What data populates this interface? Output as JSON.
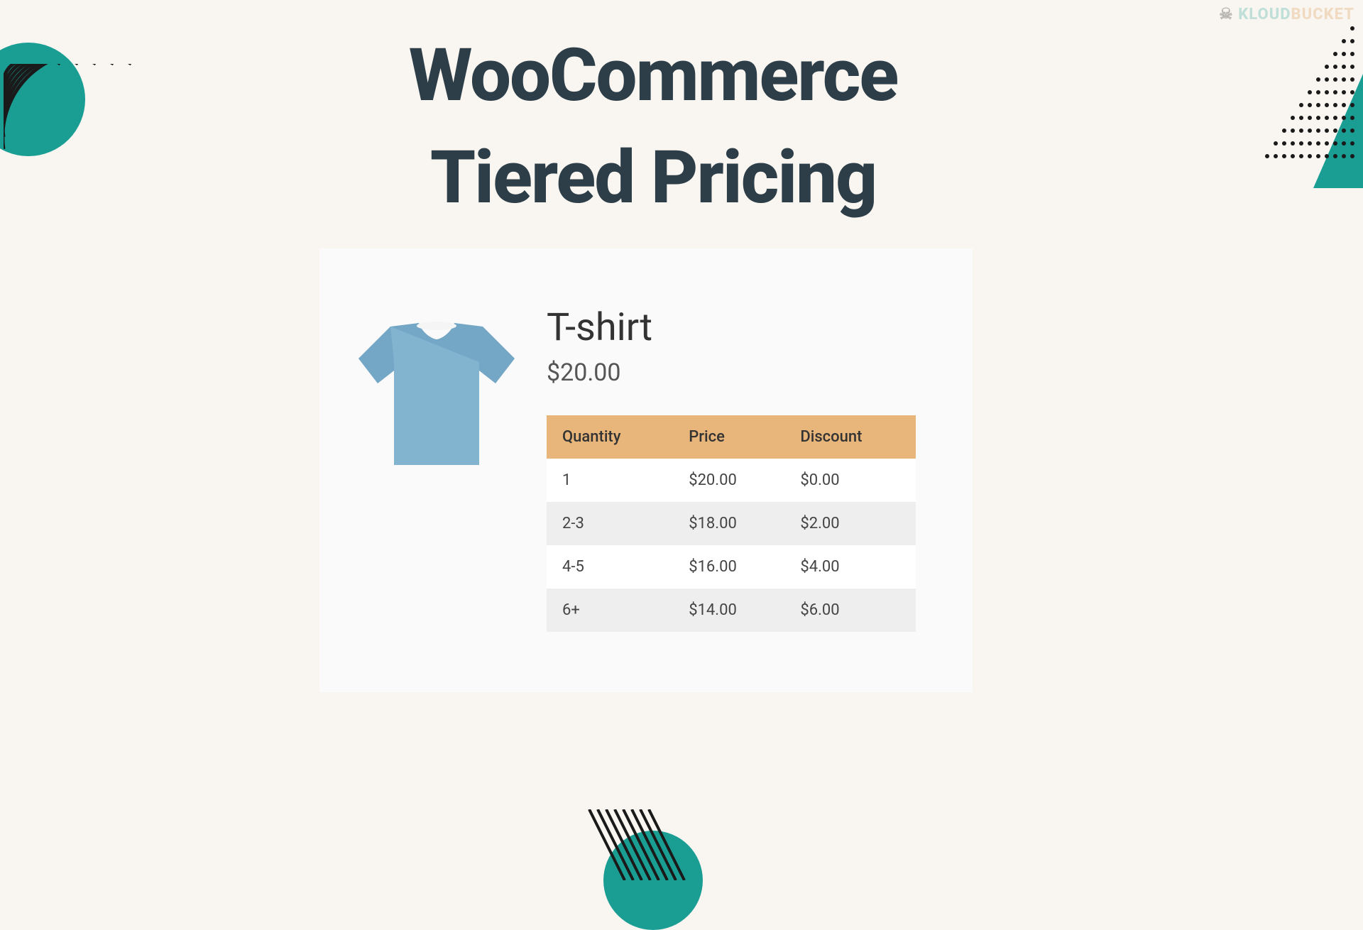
{
  "watermark": {
    "part1": "KLOUD",
    "part2": "BUCKET"
  },
  "title": {
    "line1": "WooCommerce",
    "line2": "Tiered Pricing"
  },
  "product": {
    "name": "T-shirt",
    "price": "$20.00",
    "icon": "tshirt-icon"
  },
  "table": {
    "headers": {
      "quantity": "Quantity",
      "price": "Price",
      "discount": "Discount"
    },
    "rows": [
      {
        "quantity": "1",
        "price": "$20.00",
        "discount": "$0.00"
      },
      {
        "quantity": "2-3",
        "price": "$18.00",
        "discount": "$2.00"
      },
      {
        "quantity": "4-5",
        "price": "$16.00",
        "discount": "$4.00"
      },
      {
        "quantity": "6+",
        "price": "$14.00",
        "discount": "$6.00"
      }
    ]
  }
}
